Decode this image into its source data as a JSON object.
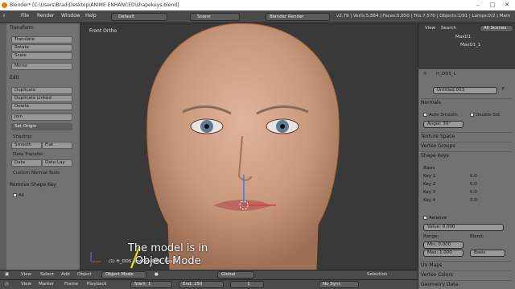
{
  "window": {
    "title": "Blender* [C:\\Users\\Brad\\Desktop\\ANIME ENHANCED\\shapekeys.blend]"
  },
  "menubar": {
    "items": [
      "File",
      "Render",
      "Window",
      "Help"
    ],
    "layout": "Default",
    "scene": "Scene",
    "engine": "Blender Render",
    "stats": "v2.79 | Verts:5,864 | Faces:5,850 | Tris:7,570 | Objects:1/91 | Lamps:0/2 | Mem"
  },
  "tools": {
    "transform_title": "Transform",
    "translate": "Translate",
    "rotate": "Rotate",
    "scale": "Scale",
    "mirror": "Mirror",
    "edit_title": "Edit",
    "duplicate": "Duplicate",
    "duplicate_linked": "Duplicate Linked",
    "delete": "Delete",
    "join": "Join",
    "set_origin": "Set Origin",
    "shading_label": "Shading:",
    "smooth": "Smooth",
    "flat": "Flat",
    "data_transfer_label": "Data Transfer:",
    "data": "Data",
    "data_lay": "Data Lay",
    "custom_normal_tools": "Custom Normal Tools",
    "remove_shape_key": "Remove Shape Key",
    "all": "All"
  },
  "viewport": {
    "view_label": "Front Ortho",
    "object_label": "(1) H_DDS_LowRes.003 : Key 0",
    "annotation_line1": "The model is in",
    "annotation_line2": "Object Mode"
  },
  "outliner": {
    "view": "View",
    "search": "Search",
    "all_scenes": "All Scenes",
    "item1": "MaxD1",
    "item2": "MaxD1_1"
  },
  "props": {
    "object_name": "H_DDS_L",
    "mesh_name": "Untitled.003",
    "f_label": "F",
    "normals": "Normals",
    "auto_smooth": "Auto Smooth",
    "double_sided": "Double Sid.",
    "angle": "Angle:  30°",
    "texture_space": "Texture Space",
    "vertex_groups": "Vertex Groups",
    "shape_keys": "Shape Keys",
    "keys": [
      {
        "name": "Basis",
        "value": ""
      },
      {
        "name": "Key 1",
        "value": "0.0"
      },
      {
        "name": "Key 2",
        "value": "0.0"
      },
      {
        "name": "Key 3",
        "value": "0.0"
      },
      {
        "name": "Key 4",
        "value": "0.0"
      }
    ],
    "relative": "Relative",
    "value": "Value:",
    "value_num": "0.000",
    "range": "Range:",
    "blend": "Blend:",
    "min": "Min:",
    "min_val": "0.000",
    "max": "Max:",
    "max_val": "1.000",
    "basis": "Basis",
    "uv_maps": "UV Maps",
    "vertex_colors": "Vertex Colors",
    "geometry_data": "Geometry Data"
  },
  "header3d": {
    "view": "View",
    "select": "Select",
    "add": "Add",
    "object": "Object",
    "mode": "Object Mode",
    "orientation": "Global",
    "selection": "Selection"
  },
  "timeline": {
    "view": "View",
    "marker": "Marker",
    "frame": "Frame",
    "playback": "Playback",
    "start": "Start:",
    "start_val": "1",
    "end": "End:",
    "end_val": "250",
    "current": "1",
    "sync": "No Sync"
  },
  "colors": {
    "accent": "#e87d0d",
    "annotation_arrow": "#f4f400"
  }
}
